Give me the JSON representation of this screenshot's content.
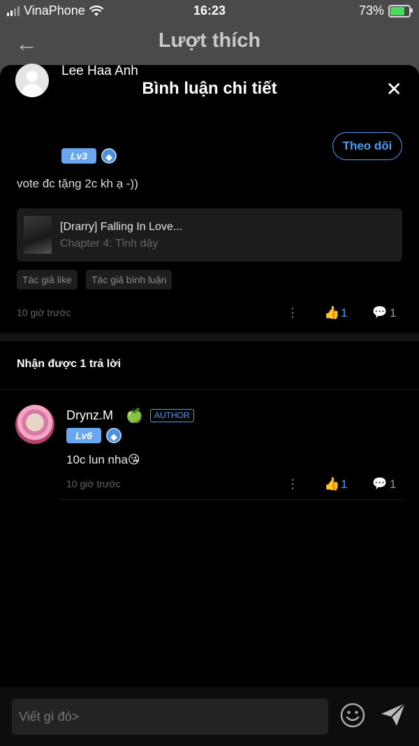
{
  "status_bar": {
    "carrier": "VinaPhone",
    "time": "16:23",
    "battery": "73%"
  },
  "background_header": {
    "title": "Lượt thích"
  },
  "sheet": {
    "title": "Bình luận chi tiết",
    "comment": {
      "user_name": "Lee Haa Anh",
      "level": "Lv3",
      "follow_label": "Theo dõi",
      "text": "vote đc tặng 2c kh ạ -))",
      "story": {
        "title": "[Drarry] Falling In Love...",
        "chapter": "Chapter 4: Tỉnh dậy"
      },
      "tags": [
        "Tác giả like",
        "Tác giả bình luận"
      ],
      "time": "10 giờ trước",
      "likes": "1",
      "replies": "1"
    },
    "replies_heading": "Nhận được 1 trả lời",
    "reply": {
      "user_name": "Drynz.M",
      "badge": "AUTHOR",
      "level": "Lv6",
      "text": "10c lun nha😘",
      "time": "10 giờ trước",
      "likes": "1",
      "replies": "1"
    }
  },
  "input": {
    "placeholder": "Viết gì đó>"
  },
  "colors": {
    "accent": "#4d9df0",
    "level_badge": "#69a8f0",
    "sheet_bg": "#000000"
  }
}
